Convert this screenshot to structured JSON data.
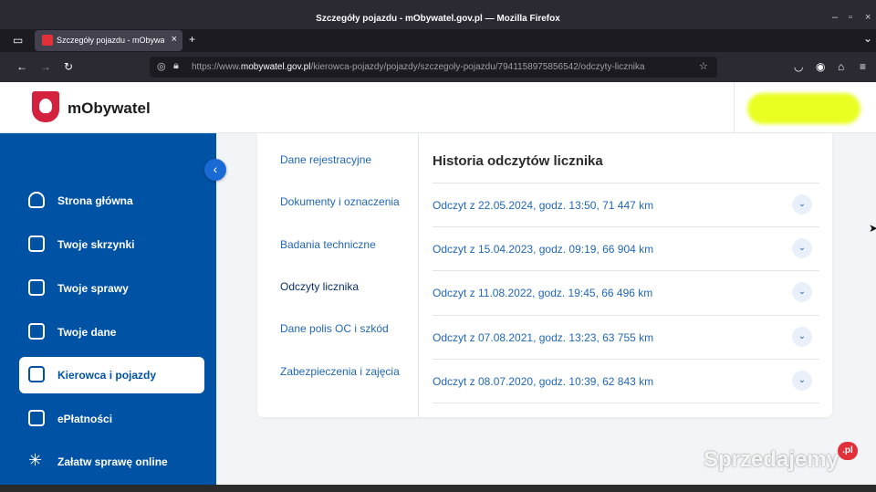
{
  "window": {
    "title": "Szczegóły pojazdu - mObywatel.gov.pl — Mozilla Firefox",
    "minimize_glyph": "–",
    "maximize_glyph": "▫",
    "close_glyph": "×"
  },
  "tabs": [
    {
      "label": "Szczegóły pojazdu - mObywatel",
      "icon": "mobywatel-favicon",
      "close_glyph": "×"
    }
  ],
  "tabstrip": {
    "new_tab_glyph": "+",
    "list_all_glyph": "⌄"
  },
  "navbar": {
    "back_glyph": "←",
    "forward_glyph": "→",
    "reload_glyph": "↻",
    "url_prefix": "https://www.",
    "url_domain": "mobywatel.gov.pl",
    "url_path": "/kierowca-pojazdy/pojazdy/szczegoly-pojazdu/7941158975856542/odczyty-licznika",
    "bookmark_glyph": "☆"
  },
  "header": {
    "brand": "mObywatel"
  },
  "sidebar": {
    "collapse_glyph": "‹",
    "items": [
      {
        "label": "Strona główna",
        "icon": "home-icon",
        "active": false
      },
      {
        "label": "Twoje skrzynki",
        "icon": "mail-icon",
        "active": false
      },
      {
        "label": "Twoje sprawy",
        "icon": "document-icon",
        "active": false
      },
      {
        "label": "Twoje dane",
        "icon": "id-card-icon",
        "active": false
      },
      {
        "label": "Kierowca i pojazdy",
        "icon": "car-icon",
        "active": true
      },
      {
        "label": "ePłatności",
        "icon": "wallet-icon",
        "active": false
      },
      {
        "label": "Załatw sprawę online",
        "icon": "click-icon",
        "active": false
      }
    ]
  },
  "subnav": {
    "items": [
      {
        "label": "Dane rejestracyjne",
        "active": false
      },
      {
        "label": "Dokumenty i oznaczenia",
        "active": false
      },
      {
        "label": "Badania techniczne",
        "active": false
      },
      {
        "label": "Odczyty licznika",
        "active": true
      },
      {
        "label": "Dane polis OC i szkód",
        "active": false
      },
      {
        "label": "Zabezpieczenia i zajęcia",
        "active": false
      }
    ]
  },
  "history": {
    "title": "Historia odczytów licznika",
    "chevron_glyph": "⌄",
    "rows": [
      {
        "label": "Odczyt z 22.05.2024, godz. 13:50, 71 447 km"
      },
      {
        "label": "Odczyt z 15.04.2023, godz. 09:19, 66 904 km"
      },
      {
        "label": "Odczyt z 11.08.2022, godz. 19:45, 66 496 km"
      },
      {
        "label": "Odczyt z 07.08.2021, godz. 13:23, 63 755 km"
      },
      {
        "label": "Odczyt z 08.07.2020, godz. 10:39, 62 843 km"
      }
    ]
  },
  "watermark": {
    "text": "Sprzedajemy",
    "badge": ".pl"
  },
  "colors": {
    "primary": "#0052a5",
    "link": "#2167b8",
    "accent_red": "#d4213d"
  }
}
